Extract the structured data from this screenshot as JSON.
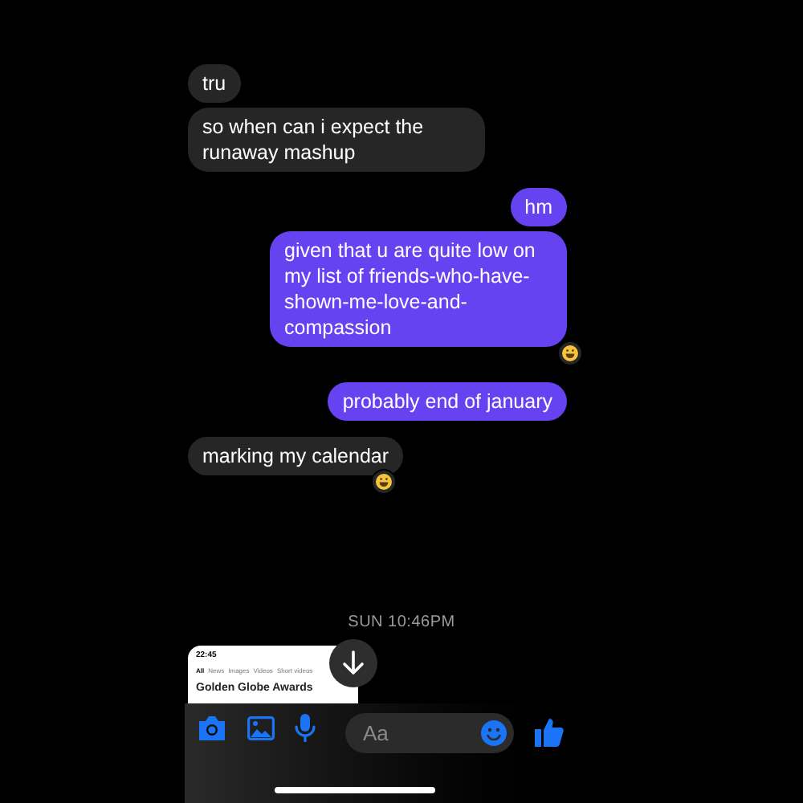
{
  "messages": [
    {
      "kind": "incoming",
      "text": "tru",
      "reaction": false
    },
    {
      "kind": "incoming",
      "text": "so when can i expect the runaway mashup",
      "reaction": false
    },
    {
      "kind": "outgoing",
      "text": "hm",
      "reaction": false
    },
    {
      "kind": "outgoing",
      "text": "given that u are quite low on my list of friends-who-have-shown-me-love-and-compassion",
      "reaction": true
    },
    {
      "kind": "outgoing",
      "text": "probably end of january",
      "reaction": false
    },
    {
      "kind": "incoming",
      "text": "marking my calendar",
      "reaction": true
    }
  ],
  "timestamp": "SUN 10:46PM",
  "attachment_preview": {
    "status_time": "22:45",
    "tabs": [
      {
        "label": "All",
        "selected": true
      },
      {
        "label": "News",
        "selected": false
      },
      {
        "label": "Images",
        "selected": false
      },
      {
        "label": "Videos",
        "selected": false
      },
      {
        "label": "Short videos",
        "selected": false
      }
    ],
    "headline": "Golden Globe Awards"
  },
  "composer": {
    "placeholder": "Aa"
  }
}
